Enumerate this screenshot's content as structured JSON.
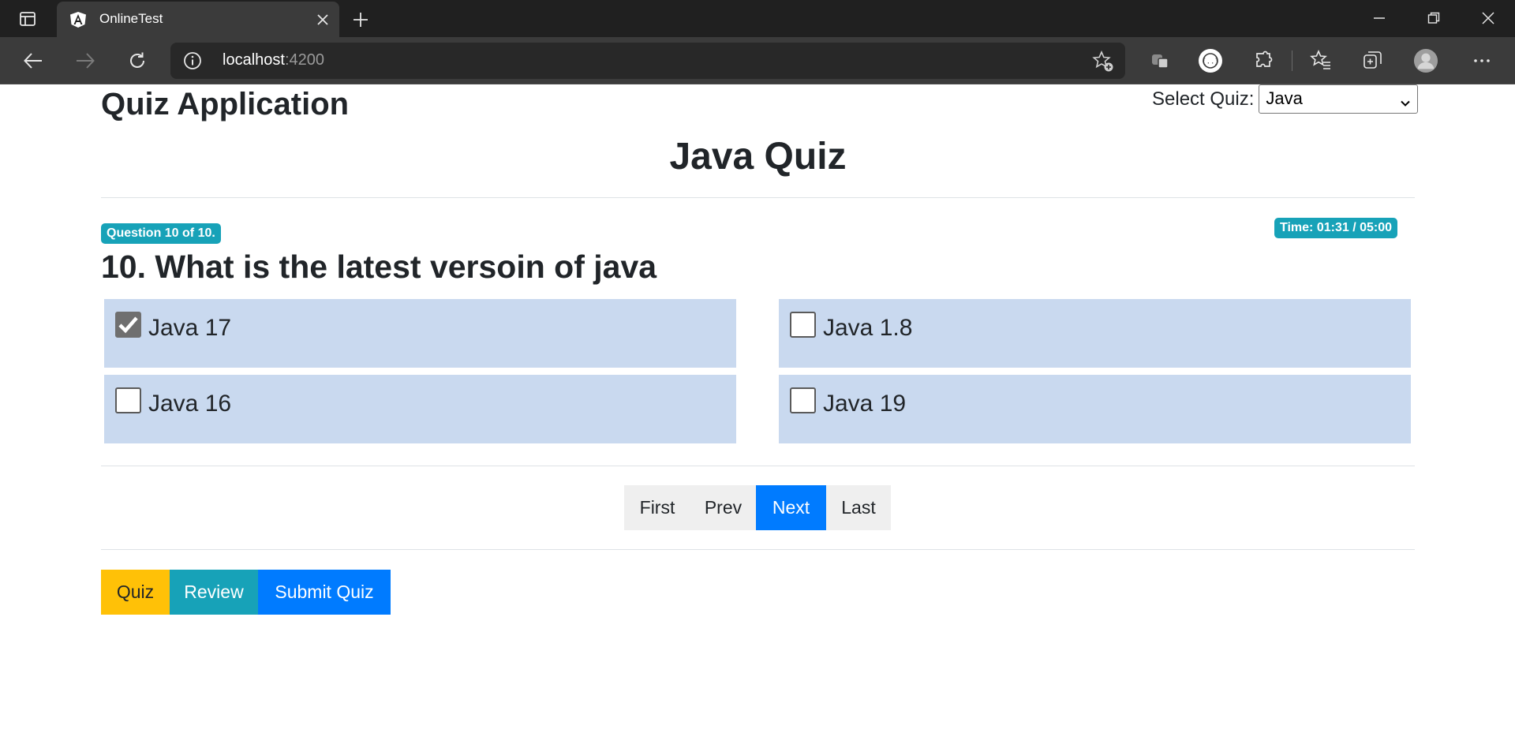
{
  "browser": {
    "tab_title": "OnlineTest",
    "address_host": "localhost",
    "address_port": ":4200"
  },
  "app": {
    "title": "Quiz Application",
    "select_label": "Select Quiz:",
    "selected_quiz": "Java"
  },
  "quiz": {
    "name": "Java Quiz",
    "question_badge": "Question 10 of 10.",
    "timer_badge": "Time: 01:31 / 05:00",
    "question": "10. What is the latest versoin of java",
    "options": [
      {
        "label": "Java 17",
        "checked": true
      },
      {
        "label": "Java 1.8",
        "checked": false
      },
      {
        "label": "Java 16",
        "checked": false
      },
      {
        "label": "Java 19",
        "checked": false
      }
    ]
  },
  "pager": {
    "first": "First",
    "prev": "Prev",
    "next": "Next",
    "last": "Last"
  },
  "actions": {
    "quiz": "Quiz",
    "review": "Review",
    "submit": "Submit Quiz"
  },
  "colors": {
    "badge": "#17a2b8",
    "option_bg": "#c9d9ef",
    "primary": "#007bff",
    "warning": "#ffc107",
    "info": "#17a2b8"
  }
}
